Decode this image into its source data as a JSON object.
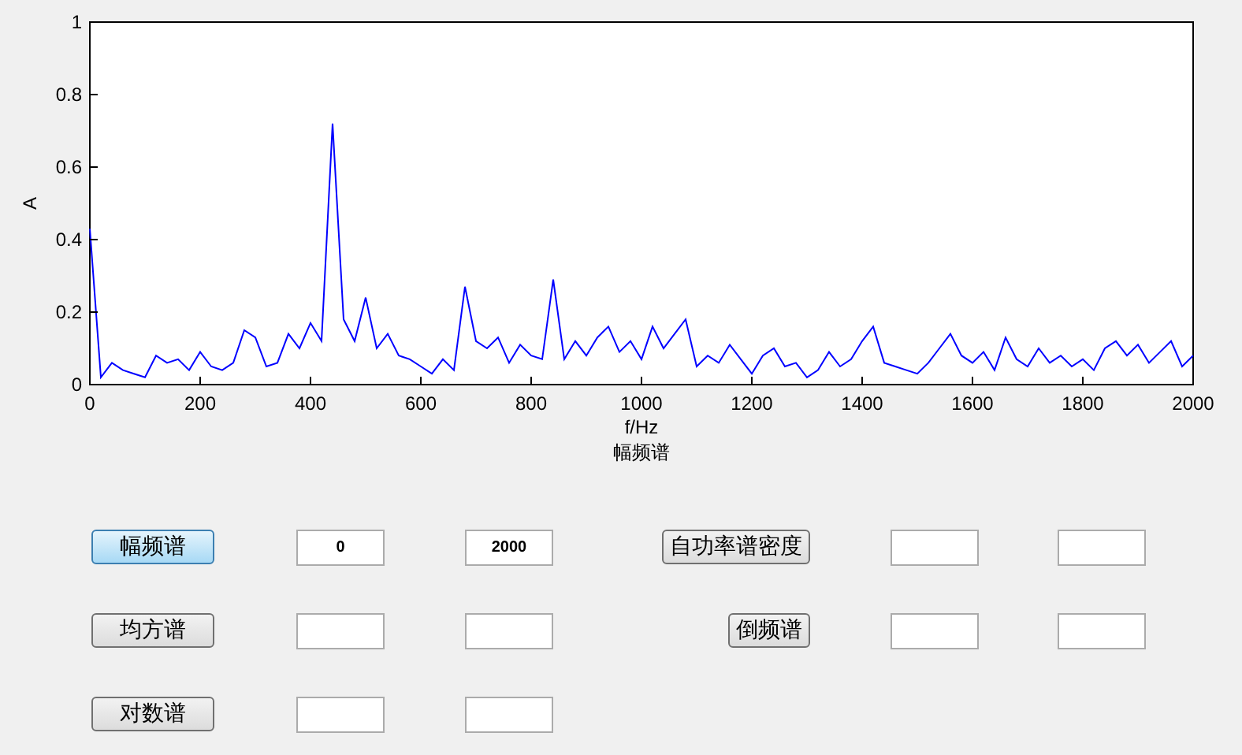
{
  "plot": {
    "chart_data": {
      "type": "line",
      "title": "幅频谱",
      "xlabel": "f/Hz",
      "ylabel": "A",
      "xlim": [
        0,
        2000
      ],
      "ylim": [
        0,
        1
      ],
      "xticks": [
        0,
        200,
        400,
        600,
        800,
        1000,
        1200,
        1400,
        1600,
        1800,
        2000
      ],
      "yticks": [
        0,
        0.2,
        0.4,
        0.6,
        0.8,
        1
      ],
      "x": [
        0,
        20,
        40,
        60,
        80,
        100,
        120,
        140,
        160,
        180,
        200,
        220,
        240,
        260,
        280,
        300,
        320,
        340,
        360,
        380,
        400,
        420,
        440,
        460,
        480,
        500,
        520,
        540,
        560,
        580,
        600,
        620,
        640,
        660,
        680,
        700,
        720,
        740,
        760,
        780,
        800,
        820,
        840,
        860,
        880,
        900,
        920,
        940,
        960,
        980,
        1000,
        1020,
        1040,
        1060,
        1080,
        1100,
        1120,
        1140,
        1160,
        1180,
        1200,
        1220,
        1240,
        1260,
        1280,
        1300,
        1320,
        1340,
        1360,
        1380,
        1400,
        1420,
        1440,
        1460,
        1480,
        1500,
        1520,
        1540,
        1560,
        1580,
        1600,
        1620,
        1640,
        1660,
        1680,
        1700,
        1720,
        1740,
        1760,
        1780,
        1800,
        1820,
        1840,
        1860,
        1880,
        1900,
        1920,
        1940,
        1960,
        1980,
        2000
      ],
      "series": [
        {
          "color": "#0000ff",
          "values": [
            0.43,
            0.02,
            0.06,
            0.04,
            0.03,
            0.02,
            0.08,
            0.06,
            0.07,
            0.04,
            0.09,
            0.05,
            0.04,
            0.06,
            0.15,
            0.13,
            0.05,
            0.06,
            0.14,
            0.1,
            0.17,
            0.12,
            0.72,
            0.18,
            0.12,
            0.24,
            0.1,
            0.14,
            0.08,
            0.07,
            0.05,
            0.03,
            0.07,
            0.04,
            0.27,
            0.12,
            0.1,
            0.13,
            0.06,
            0.11,
            0.08,
            0.07,
            0.29,
            0.07,
            0.12,
            0.08,
            0.13,
            0.16,
            0.09,
            0.12,
            0.07,
            0.16,
            0.1,
            0.14,
            0.18,
            0.05,
            0.08,
            0.06,
            0.11,
            0.07,
            0.03,
            0.08,
            0.1,
            0.05,
            0.06,
            0.02,
            0.04,
            0.09,
            0.05,
            0.07,
            0.12,
            0.16,
            0.06,
            0.05,
            0.04,
            0.03,
            0.06,
            0.1,
            0.14,
            0.08,
            0.06,
            0.09,
            0.04,
            0.13,
            0.07,
            0.05,
            0.1,
            0.06,
            0.08,
            0.05,
            0.07,
            0.04,
            0.1,
            0.12,
            0.08,
            0.11,
            0.06,
            0.09,
            0.12,
            0.05,
            0.08
          ]
        }
      ]
    }
  },
  "controls": [
    {
      "items": [
        {
          "kind": "button",
          "label": "幅频谱",
          "selected": true
        },
        {
          "kind": "field",
          "value": "0"
        },
        {
          "kind": "field",
          "value": "2000"
        },
        {
          "kind": "button",
          "label": "自功率谱密度",
          "selected": false
        },
        {
          "kind": "field"
        },
        {
          "kind": "field"
        }
      ]
    },
    {
      "items": [
        {
          "kind": "button",
          "label": "均方谱",
          "selected": false
        },
        {
          "kind": "field"
        },
        {
          "kind": "field"
        },
        {
          "kind": "button",
          "label": "倒频谱",
          "selected": false
        },
        {
          "kind": "field"
        },
        {
          "kind": "field"
        }
      ]
    },
    {
      "items": [
        {
          "kind": "button",
          "label": "对数谱",
          "selected": false
        },
        {
          "kind": "field"
        },
        {
          "kind": "field"
        }
      ]
    }
  ]
}
